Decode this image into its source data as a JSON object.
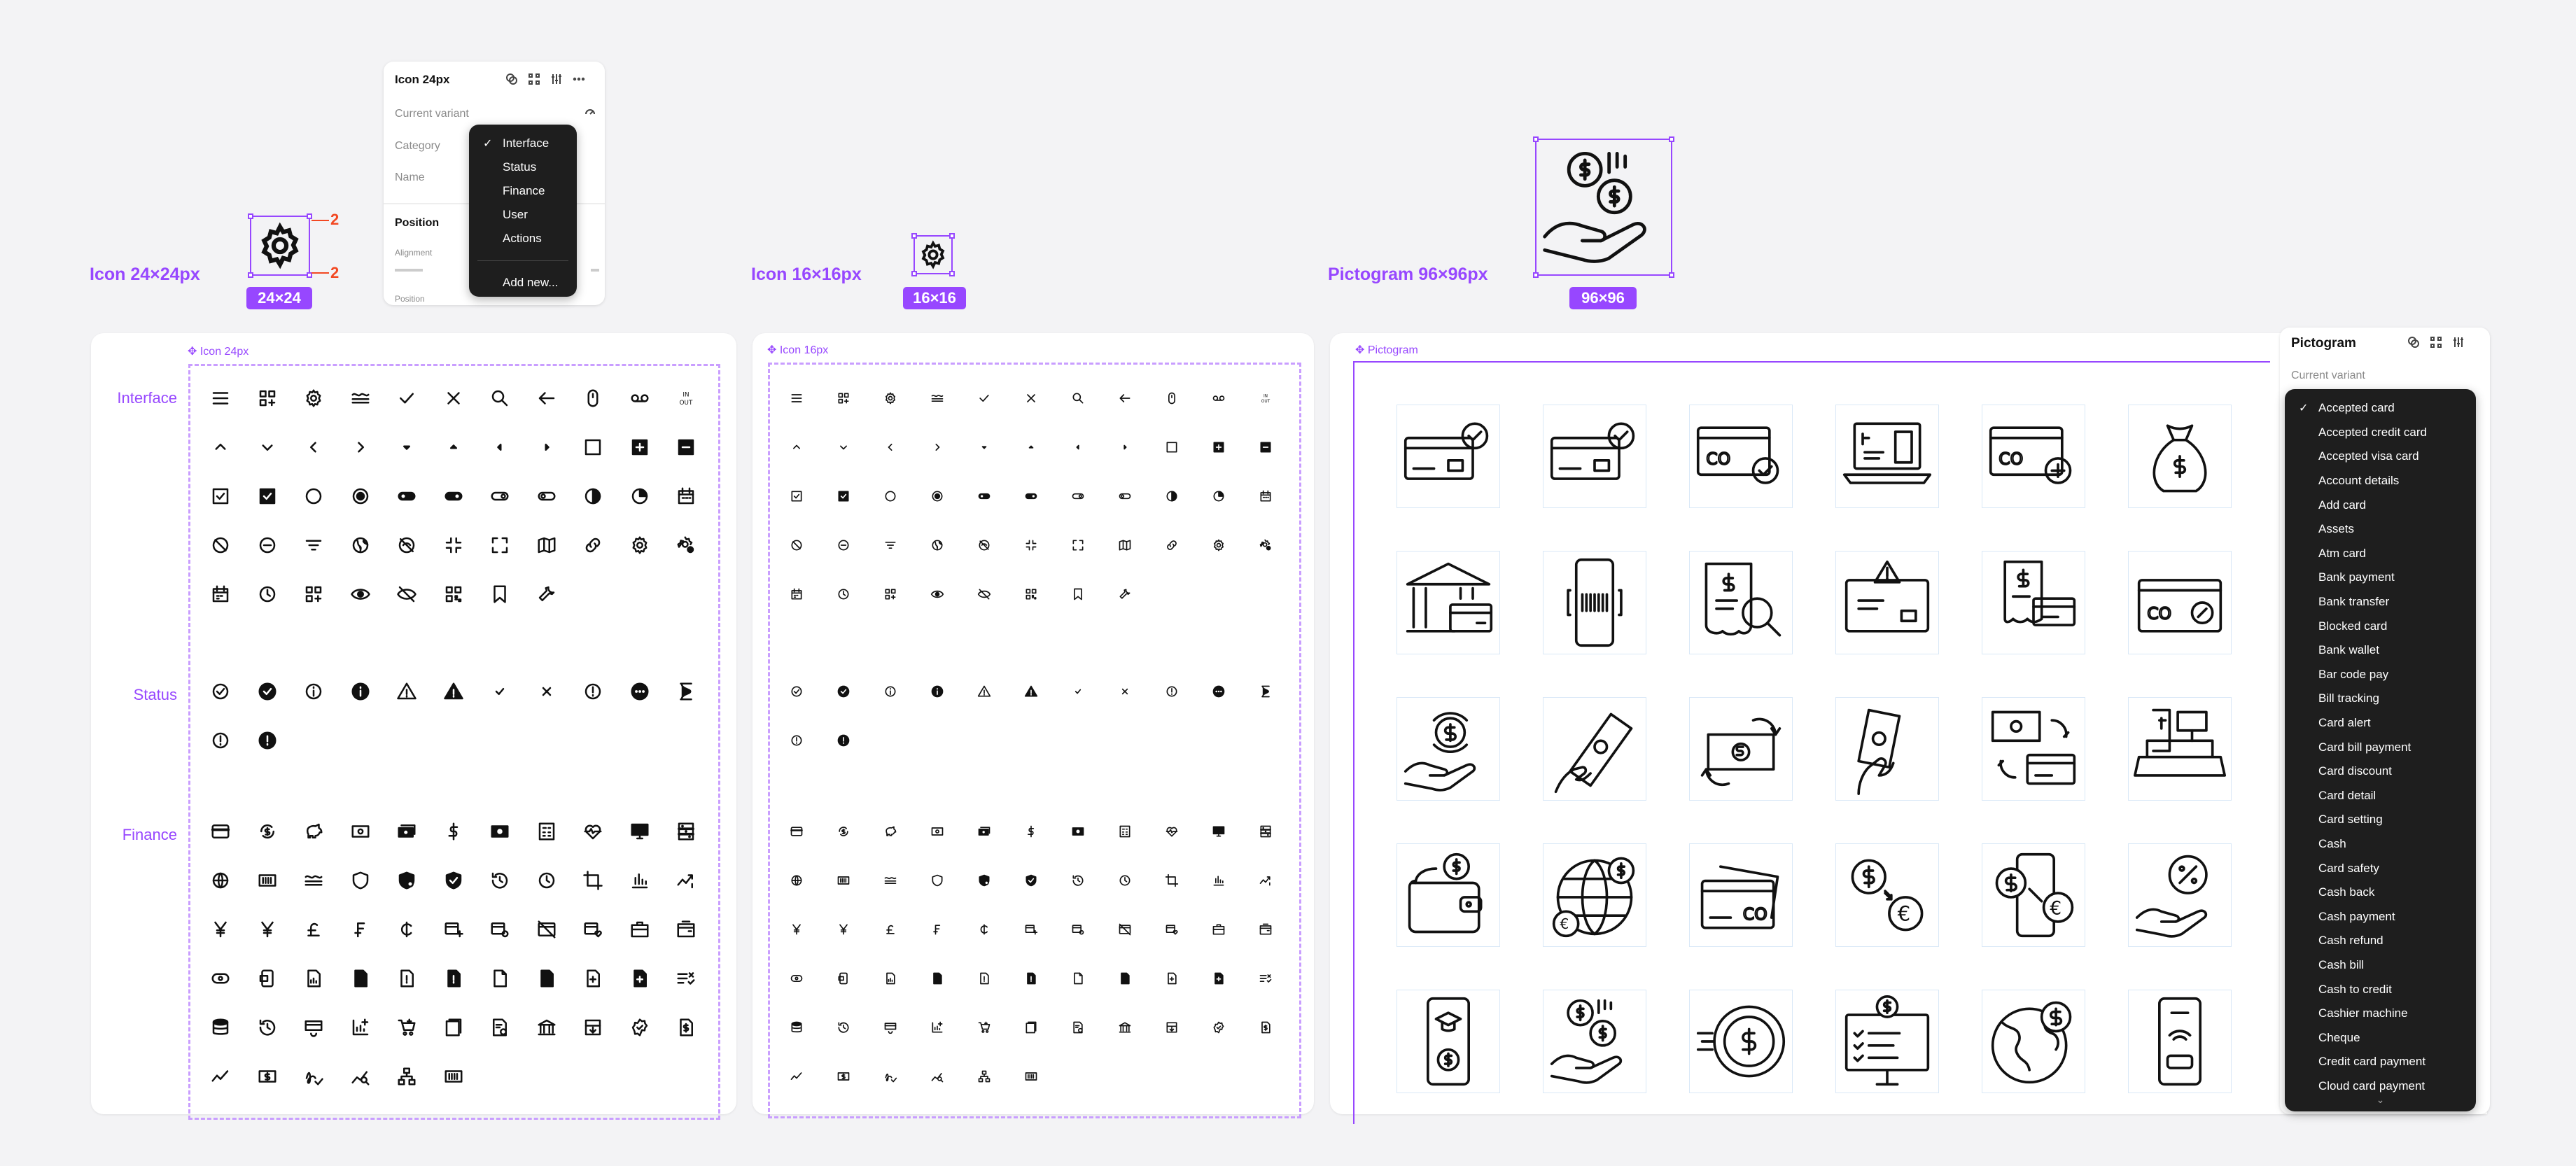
{
  "labels": {
    "icon24_title": "Icon 24×24px",
    "icon24_badge": "24×24",
    "icon16_title": "Icon 16×16px",
    "icon16_badge": "16×16",
    "pictogram_title": "Pictogram 96×96px",
    "pictogram_badge": "96×96",
    "measure_top": "2",
    "measure_bottom": "2"
  },
  "props_panel": {
    "title": "Icon 24px",
    "current_variant": "Current variant",
    "category_label": "Category",
    "name_label": "Name",
    "position_label": "Position",
    "alignment_label": "Alignment",
    "position_sub": "Position",
    "menu": {
      "selected": "Interface",
      "items": [
        "Interface",
        "Status",
        "Finance",
        "User",
        "Actions"
      ],
      "add_new": "Add new..."
    }
  },
  "frames": {
    "icon24": "Icon 24px",
    "icon16": "Icon 16px",
    "pictogram": "Pictogram"
  },
  "categories": {
    "interface": "Interface",
    "status": "Status",
    "finance": "Finance"
  },
  "icons": {
    "interface_rows": [
      [
        "menu-icon",
        "qr-add-icon",
        "gear-icon",
        "waves-icon",
        "check-icon",
        "close-icon",
        "search-icon",
        "arrow-left-icon",
        "mouse-icon",
        "voicemail-icon",
        "in-out-icon"
      ],
      [
        "chevron-up-icon",
        "chevron-down-icon",
        "chevron-left-icon",
        "chevron-right-icon",
        "caret-down-icon",
        "caret-up-icon",
        "caret-left-icon",
        "caret-right-icon",
        "square-icon",
        "plus-square-icon",
        "minus-square-icon"
      ],
      [
        "checkbox-icon",
        "checkbox-filled-icon",
        "radio-icon",
        "radio-filled-icon",
        "toggle-off-icon",
        "toggle-on-icon",
        "toggle-off-outline-icon",
        "toggle-on-outline-icon",
        "contrast-icon",
        "pie-icon",
        "calendar-icon"
      ],
      [
        "block-icon",
        "minus-circle-icon",
        "filter-icon",
        "globe-icon",
        "eye-off-circle-icon",
        "collapse-icon",
        "expand-icon",
        "map-icon",
        "link-icon",
        "settings-icon",
        "settings-alt-icon"
      ],
      [
        "calendar-alt-icon",
        "clock-icon",
        "grid-add-icon",
        "eye-icon",
        "eye-off-icon",
        "qr-icon",
        "bookmark-icon",
        "wrench-icon"
      ]
    ],
    "status_rows": [
      [
        "check-circle-icon",
        "check-circle-filled-icon",
        "info-icon",
        "info-filled-icon",
        "warning-icon",
        "warning-filled-icon",
        "check-small-icon",
        "close-small-icon",
        "alert-circle-icon",
        "more-circle-icon",
        "hourglass-icon"
      ],
      [
        "alert-icon",
        "alert-filled-icon"
      ]
    ],
    "finance_rows": [
      [
        "credit-card-icon",
        "dollar-cycle-icon",
        "piggy-bank-icon",
        "cash-icon",
        "cash-stack-icon",
        "dollar-icon",
        "banknote-icon",
        "calculator-icon",
        "heartbeat-icon",
        "monitor-icon",
        "abacus-icon"
      ],
      [
        "globe-alt-icon",
        "barcode-icon",
        "waves-alt-icon",
        "shield-icon",
        "shield-pie-icon",
        "shield-check-icon",
        "history-icon",
        "clock-alt-icon",
        "crop-icon",
        "bar-chart-icon",
        "trend-icon"
      ],
      [
        "yen-icon",
        "yuan-icon",
        "pound-icon",
        "franc-icon",
        "cedi-icon",
        "card-add-icon",
        "card-settings-icon",
        "card-off-icon",
        "card-heart-icon",
        "briefcase-icon",
        "wallet-alt-icon"
      ],
      [
        "coin-icon",
        "phone-card-icon",
        "document-chart-icon",
        "document-filled-icon",
        "document-alert-icon",
        "document-alert-filled-icon",
        "document-icon",
        "document-dark-icon",
        "document-plus-icon",
        "document-plus-filled-icon",
        "list-check-icon"
      ],
      [
        "database-icon",
        "history-alt-icon",
        "card-refresh-icon",
        "chart-add-icon",
        "cart-add-icon",
        "calculator-alt-icon",
        "receipt-icon",
        "bank-icon",
        "archive-icon",
        "badge-check-icon",
        "invoice-icon"
      ],
      [
        "line-chart-icon",
        "dollar-square-icon",
        "signature-icon",
        "chart-search-icon",
        "hierarchy-icon",
        "barcode-alt-icon"
      ]
    ]
  },
  "pictograms": [
    [
      "card-check",
      "card-check-alt",
      "card-co-check",
      "laptop-dollar",
      "card-co-plus",
      "money-bag"
    ],
    [
      "bank-building",
      "phone-barcode",
      "receipt-search",
      "card-warning",
      "receipt-card",
      "card-discount"
    ],
    [
      "hand-dollar-cycle",
      "hand-cash",
      "cash-exchange",
      "hand-money-swipe",
      "cash-card-exchange",
      "cash-register"
    ],
    [
      "wallet-dollar",
      "globe-currency",
      "cards-co",
      "dollar-euro-exchange",
      "phone-dollar-euro",
      "hand-percent"
    ],
    [
      "phone-education",
      "hand-coins",
      "fast-dollar",
      "monitor-dollar",
      "earth-dollar",
      "phone-card"
    ]
  ],
  "picto_panel": {
    "title": "Pictogram",
    "current_variant": "Current variant",
    "selected": "Accepted card",
    "items": [
      "Accepted card",
      "Accepted credit card",
      "Accepted visa card",
      "Account details",
      "Add card",
      "Assets",
      "Atm card",
      "Bank payment",
      "Bank transfer",
      "Blocked card",
      "Bank wallet",
      "Bar code pay",
      "Bill tracking",
      "Card alert",
      "Card bill payment",
      "Card discount",
      "Card detail",
      "Card setting",
      "Cash",
      "Card safety",
      "Cash back",
      "Cash payment",
      "Cash refund",
      "Cash bill",
      "Cash to credit",
      "Cashier machine",
      "Cheque",
      "Credit card payment",
      "Cloud card payment"
    ]
  }
}
